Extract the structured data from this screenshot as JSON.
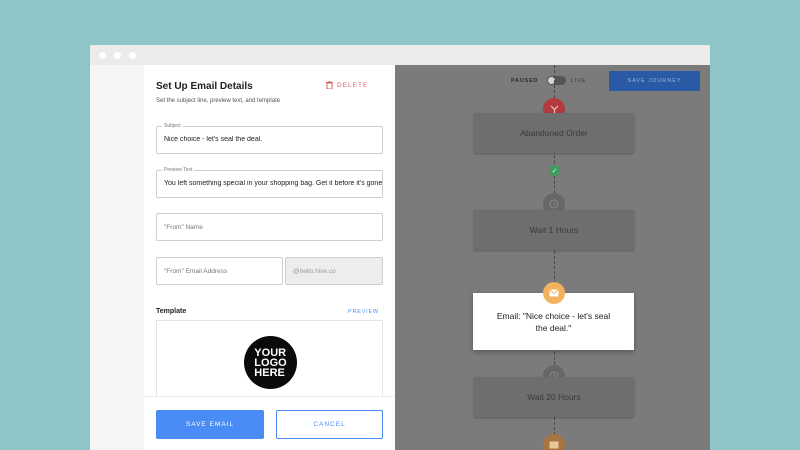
{
  "panel": {
    "title": "Set Up Email Details",
    "subtitle": "Set the subject line, preview text, and template",
    "delete_label": "DELETE",
    "subject": {
      "label": "Subject",
      "value": "Nice choice - let's seal the deal."
    },
    "preview_text": {
      "label": "Preview Text",
      "value": "You left something special in your shopping bag. Get it before it's gone!"
    },
    "from_name": {
      "placeholder": "\"From\" Name"
    },
    "from_email": {
      "placeholder": "\"From\" Email Address",
      "domain": "@hello.hive.co"
    },
    "template_label": "Template",
    "preview_link": "PREVIEW",
    "logo_lines": [
      "YOUR",
      "LOGO",
      "HERE"
    ],
    "save_label": "SAVE EMAIL",
    "cancel_label": "CANCEL"
  },
  "toolbar": {
    "paused_label": "PAUSED",
    "live_label": "LIVE",
    "save_journey_label": "SAVE JOURNEY",
    "live_enabled": false
  },
  "journey": {
    "nodes": [
      {
        "label": "Abandoned Order",
        "icon": "filter-icon",
        "color": "#b33a3f"
      },
      {
        "label": "Wait 1 Hours",
        "icon": "clock-icon"
      },
      {
        "label": "Email: \"Nice choice - let's seal the deal.\"",
        "icon": "mail-icon",
        "active": true,
        "color": "#f3b25e"
      },
      {
        "label": "Wait 20 Hours",
        "icon": "clock-icon"
      },
      {
        "label": "",
        "icon": "mail-icon"
      }
    ]
  },
  "colors": {
    "accent": "#4a8cf6",
    "danger": "#e05c5c",
    "background": "#8ec6c8",
    "success": "#3e9a5f"
  }
}
